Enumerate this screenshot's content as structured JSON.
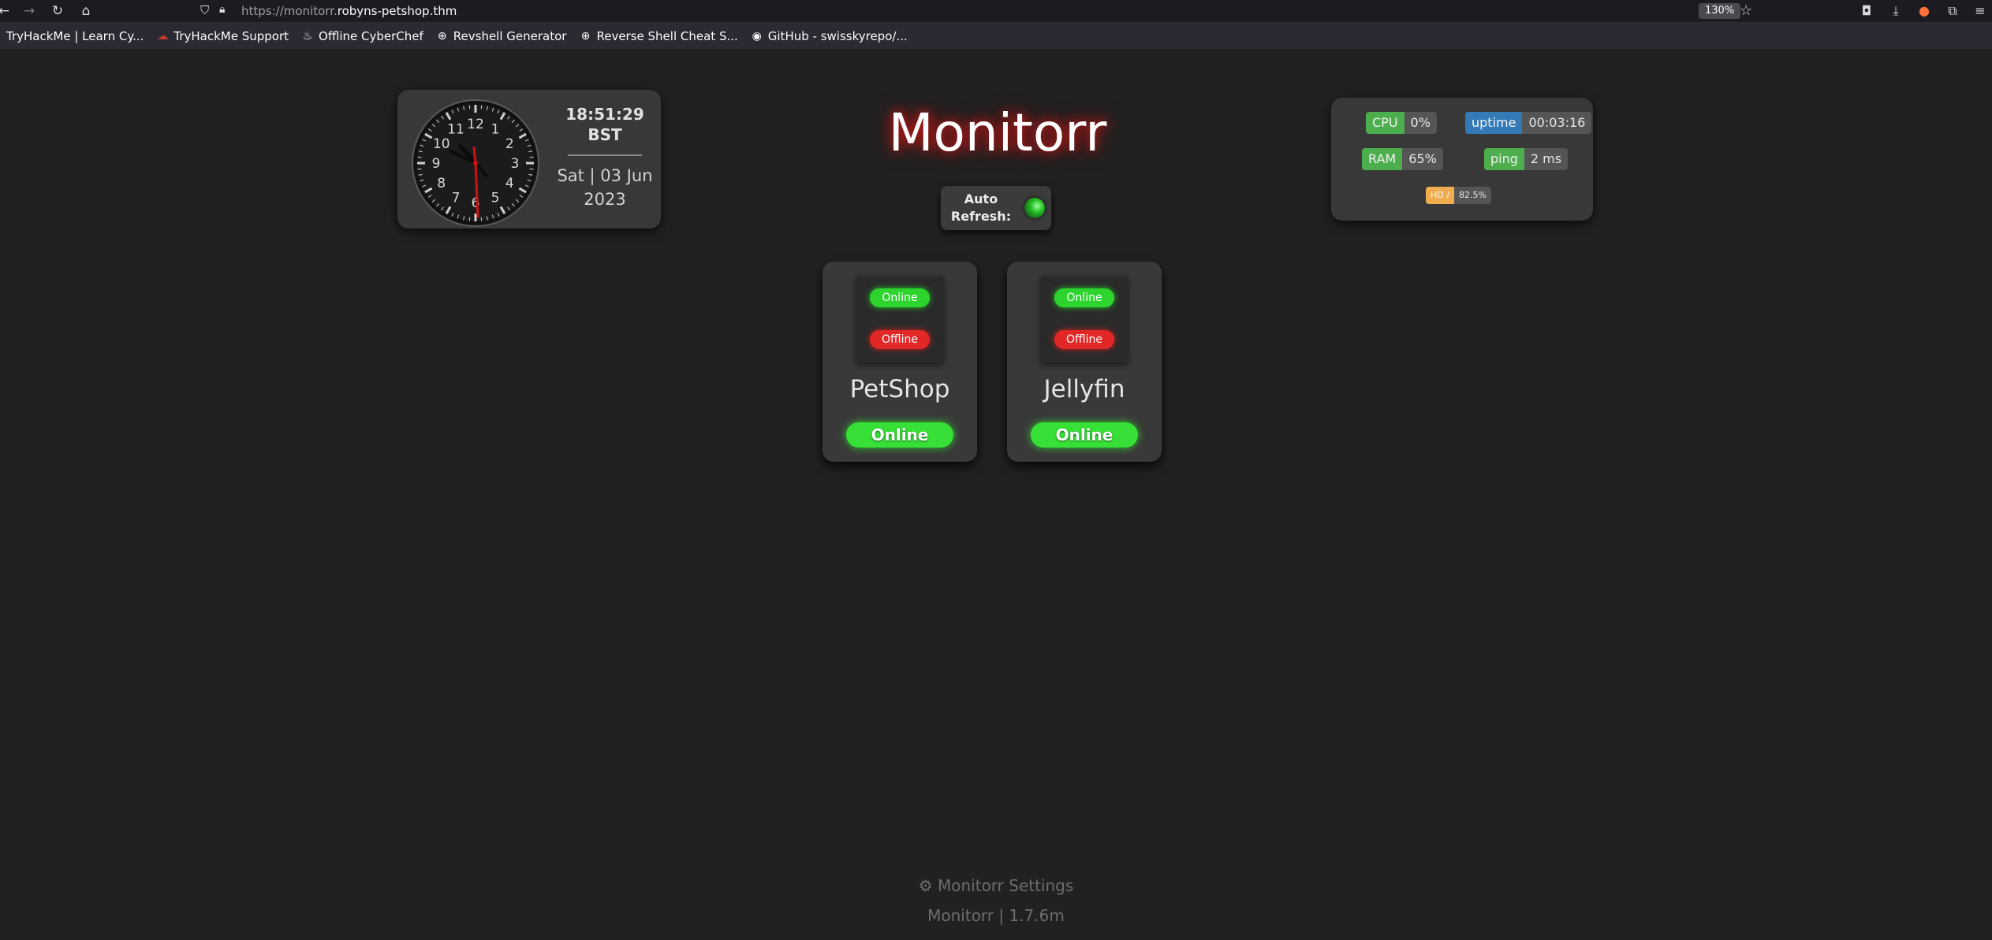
{
  "browser": {
    "url_prefix": "https://monitorr.",
    "url_host": "robyns-petshop.thm",
    "zoom": "130%",
    "bookmarks": [
      {
        "label": "TryHackMe | Learn Cy...",
        "icon": "tryhackme-icon"
      },
      {
        "label": "TryHackMe Support",
        "icon": "tryhackme-support-icon"
      },
      {
        "label": "Offline CyberChef",
        "icon": "chef-hat-icon"
      },
      {
        "label": "Revshell Generator",
        "icon": "globe-icon"
      },
      {
        "label": "Reverse Shell Cheat S...",
        "icon": "globe-icon"
      },
      {
        "label": "GitHub - swisskyrepo/...",
        "icon": "github-icon"
      }
    ]
  },
  "clock": {
    "time": "18:51:29",
    "timezone": "BST",
    "date_line1": "Sat | 03 Jun",
    "date_line2": "2023",
    "numerals": [
      "12",
      "1",
      "2",
      "3",
      "4",
      "5",
      "6",
      "7",
      "8",
      "9",
      "10",
      "11"
    ]
  },
  "header": {
    "title": "Monitorr",
    "auto_refresh_label": "Auto Refresh:"
  },
  "stats": {
    "cpu_label": "CPU",
    "cpu_value": "0%",
    "uptime_label": "uptime",
    "uptime_value": "00:03:16",
    "ram_label": "RAM",
    "ram_value": "65%",
    "ping_label": "ping",
    "ping_value": "2 ms",
    "hd_label": "HD /",
    "hd_value": "82.5%",
    "colors": {
      "green": "#4cae4c",
      "blue": "#337ab7",
      "orange": "#f0ad4e"
    }
  },
  "services": [
    {
      "name": "PetShop",
      "status": "Online",
      "online_label": "Online",
      "offline_label": "Offline"
    },
    {
      "name": "Jellyfin",
      "status": "Online",
      "online_label": "Online",
      "offline_label": "Offline"
    }
  ],
  "footer": {
    "settings_label": "Monitorr Settings",
    "version": "Monitorr | 1.7.6m"
  }
}
